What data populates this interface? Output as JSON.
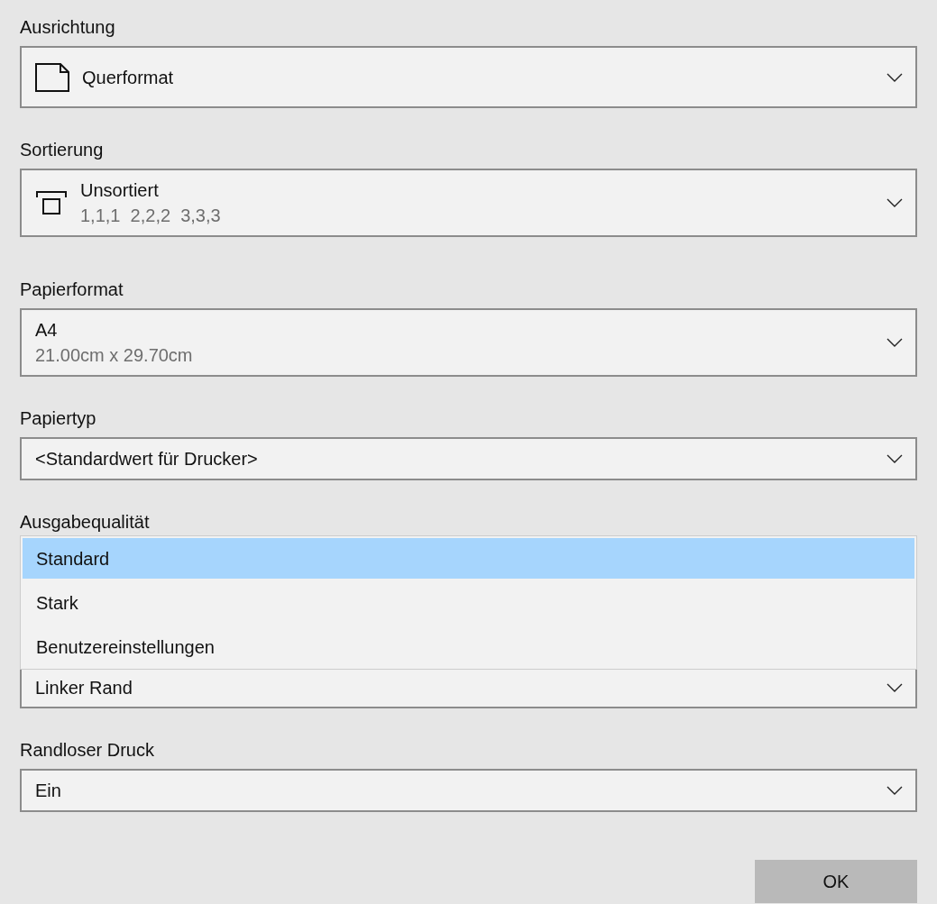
{
  "settings": [
    {
      "kind": "orientation",
      "label": "Ausrichtung",
      "value": "Querformat"
    },
    {
      "kind": "collation",
      "label": "Sortierung",
      "value": "Unsortiert",
      "detail": "1,1,1  2,2,2  3,3,3"
    },
    {
      "kind": "plain",
      "label": "Papierformat",
      "value": "A4",
      "detail": "21.00cm x 29.70cm"
    },
    {
      "kind": "plain",
      "label": "Papiertyp",
      "value": "<Standardwert für Drucker>"
    },
    {
      "kind": "open",
      "label": "Ausgabequalität",
      "options": [
        {
          "label": "Standard",
          "selected": true
        },
        {
          "label": "Stark",
          "selected": false
        },
        {
          "label": "Benutzereinstellungen",
          "selected": false
        }
      ]
    },
    {
      "kind": "plain",
      "value": "Linker Rand"
    },
    {
      "kind": "plain",
      "label": "Randloser Druck",
      "value": "Ein"
    }
  ],
  "ok_button": "OK"
}
